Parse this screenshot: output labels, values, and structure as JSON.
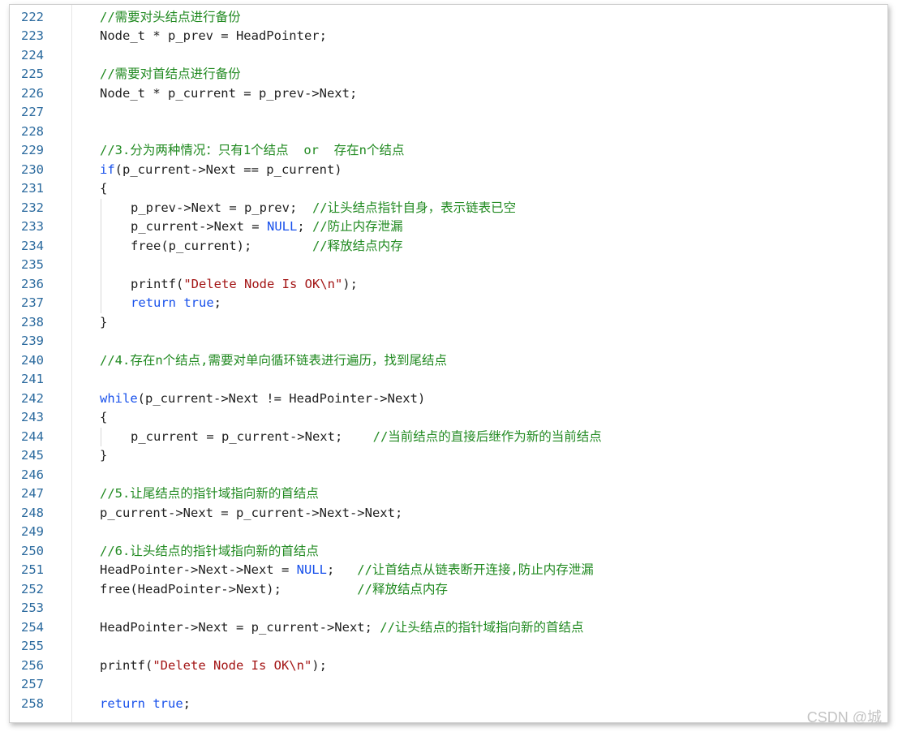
{
  "editor": {
    "lines": [
      {
        "n": "222",
        "indent": 0,
        "parts": [
          {
            "t": "//需要对头结点进行备份",
            "c": "cm"
          }
        ]
      },
      {
        "n": "223",
        "indent": 0,
        "parts": [
          {
            "t": "Node_t * p_prev = HeadPointer;",
            "c": ""
          }
        ]
      },
      {
        "n": "224",
        "indent": 0,
        "parts": []
      },
      {
        "n": "225",
        "indent": 0,
        "parts": [
          {
            "t": "//需要对首结点进行备份",
            "c": "cm"
          }
        ]
      },
      {
        "n": "226",
        "indent": 0,
        "parts": [
          {
            "t": "Node_t * p_current = p_prev->Next;",
            "c": ""
          }
        ]
      },
      {
        "n": "227",
        "indent": 0,
        "parts": []
      },
      {
        "n": "228",
        "indent": 0,
        "parts": []
      },
      {
        "n": "229",
        "indent": 0,
        "parts": [
          {
            "t": "//3.分为两种情况：只有1个结点  or  存在n个结点",
            "c": "cm"
          }
        ]
      },
      {
        "n": "230",
        "indent": 0,
        "parts": [
          {
            "t": "if",
            "c": "kw"
          },
          {
            "t": "(p_current->Next == p_current)",
            "c": ""
          }
        ]
      },
      {
        "n": "231",
        "indent": 0,
        "parts": [
          {
            "t": "{",
            "c": ""
          }
        ]
      },
      {
        "n": "232",
        "indent": 1,
        "parts": [
          {
            "t": "p_prev->Next = p_prev;  ",
            "c": ""
          },
          {
            "t": "//让头结点指针自身，表示链表已空",
            "c": "cm"
          }
        ]
      },
      {
        "n": "233",
        "indent": 1,
        "parts": [
          {
            "t": "p_current->Next = ",
            "c": ""
          },
          {
            "t": "NULL",
            "c": "kw"
          },
          {
            "t": "; ",
            "c": ""
          },
          {
            "t": "//防止内存泄漏",
            "c": "cm"
          }
        ]
      },
      {
        "n": "234",
        "indent": 1,
        "parts": [
          {
            "t": "free(p_current);        ",
            "c": ""
          },
          {
            "t": "//释放结点内存",
            "c": "cm"
          }
        ]
      },
      {
        "n": "235",
        "indent": 1,
        "parts": []
      },
      {
        "n": "236",
        "indent": 1,
        "parts": [
          {
            "t": "printf(",
            "c": ""
          },
          {
            "t": "\"Delete Node Is OK\\n\"",
            "c": "st"
          },
          {
            "t": ");",
            "c": ""
          }
        ]
      },
      {
        "n": "237",
        "indent": 1,
        "parts": [
          {
            "t": "return",
            "c": "kw"
          },
          {
            "t": " ",
            "c": ""
          },
          {
            "t": "true",
            "c": "kw"
          },
          {
            "t": ";",
            "c": ""
          }
        ]
      },
      {
        "n": "238",
        "indent": 0,
        "parts": [
          {
            "t": "}",
            "c": ""
          }
        ]
      },
      {
        "n": "239",
        "indent": 0,
        "parts": []
      },
      {
        "n": "240",
        "indent": 0,
        "parts": [
          {
            "t": "//4.存在n个结点,需要对单向循环链表进行遍历，找到尾结点",
            "c": "cm"
          }
        ]
      },
      {
        "n": "241",
        "indent": 0,
        "parts": []
      },
      {
        "n": "242",
        "indent": 0,
        "parts": [
          {
            "t": "while",
            "c": "kw"
          },
          {
            "t": "(p_current->Next != HeadPointer->Next)",
            "c": ""
          }
        ]
      },
      {
        "n": "243",
        "indent": 0,
        "parts": [
          {
            "t": "{",
            "c": ""
          }
        ]
      },
      {
        "n": "244",
        "indent": 1,
        "parts": [
          {
            "t": "p_current = p_current->Next;    ",
            "c": ""
          },
          {
            "t": "//当前结点的直接后继作为新的当前结点",
            "c": "cm"
          }
        ]
      },
      {
        "n": "245",
        "indent": 0,
        "parts": [
          {
            "t": "}",
            "c": ""
          }
        ]
      },
      {
        "n": "246",
        "indent": 0,
        "parts": []
      },
      {
        "n": "247",
        "indent": 0,
        "parts": [
          {
            "t": "//5.让尾结点的指针域指向新的首结点",
            "c": "cm"
          }
        ]
      },
      {
        "n": "248",
        "indent": 0,
        "parts": [
          {
            "t": "p_current->Next = p_current->Next->Next;",
            "c": ""
          }
        ]
      },
      {
        "n": "249",
        "indent": 0,
        "parts": []
      },
      {
        "n": "250",
        "indent": 0,
        "parts": [
          {
            "t": "//6.让头结点的指针域指向新的首结点",
            "c": "cm"
          }
        ]
      },
      {
        "n": "251",
        "indent": 0,
        "parts": [
          {
            "t": "HeadPointer->Next->Next = ",
            "c": ""
          },
          {
            "t": "NULL",
            "c": "kw"
          },
          {
            "t": ";   ",
            "c": ""
          },
          {
            "t": "//让首结点从链表断开连接,防止内存泄漏",
            "c": "cm"
          }
        ]
      },
      {
        "n": "252",
        "indent": 0,
        "parts": [
          {
            "t": "free(HeadPointer->Next);          ",
            "c": ""
          },
          {
            "t": "//释放结点内存",
            "c": "cm"
          }
        ]
      },
      {
        "n": "253",
        "indent": 0,
        "parts": []
      },
      {
        "n": "254",
        "indent": 0,
        "parts": [
          {
            "t": "HeadPointer->Next = p_current->Next; ",
            "c": ""
          },
          {
            "t": "//让头结点的指针域指向新的首结点",
            "c": "cm"
          }
        ]
      },
      {
        "n": "255",
        "indent": 0,
        "parts": []
      },
      {
        "n": "256",
        "indent": 0,
        "parts": [
          {
            "t": "printf(",
            "c": ""
          },
          {
            "t": "\"Delete Node Is OK\\n\"",
            "c": "st"
          },
          {
            "t": ");",
            "c": ""
          }
        ]
      },
      {
        "n": "257",
        "indent": 0,
        "parts": []
      },
      {
        "n": "258",
        "indent": 0,
        "parts": [
          {
            "t": "return",
            "c": "kw"
          },
          {
            "t": " ",
            "c": ""
          },
          {
            "t": "true",
            "c": "kw"
          },
          {
            "t": ";",
            "c": ""
          }
        ]
      }
    ]
  },
  "watermark": "CSDN @城"
}
